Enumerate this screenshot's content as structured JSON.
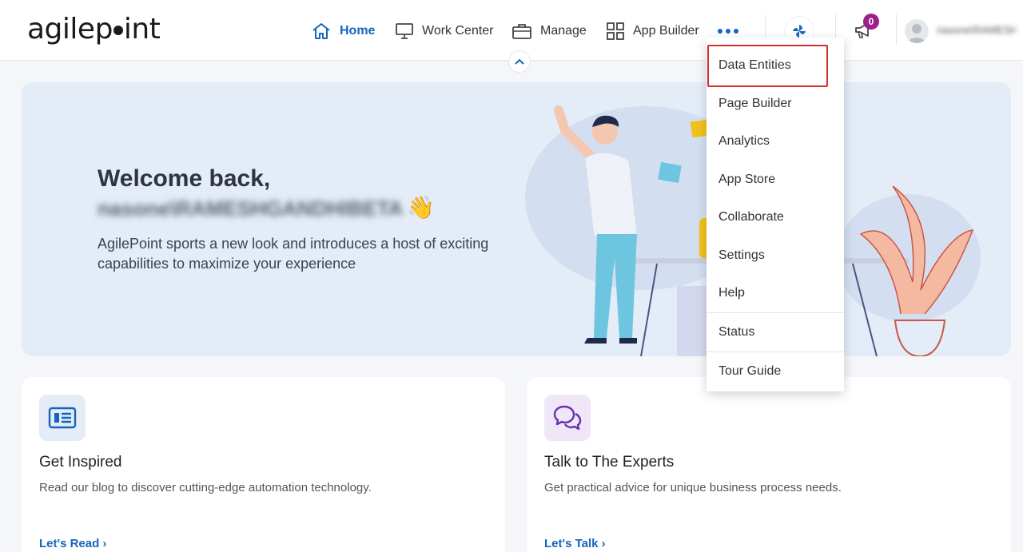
{
  "brand": {
    "logo_text_a": "agilep",
    "logo_text_b": "int"
  },
  "nav": {
    "home": "Home",
    "work_center": "Work Center",
    "manage": "Manage",
    "app_builder": "App Builder"
  },
  "notifications": {
    "count": "0"
  },
  "user": {
    "name": "nasone\\RAMESHGANDHIBETA"
  },
  "hero": {
    "title": "Welcome back,",
    "name": "nasone\\RAMESHGANDHIBETA",
    "wave": "👋",
    "description": "AgilePoint sports a new look and introduces a host of exciting capabilities to maximize your experience"
  },
  "cards": [
    {
      "title": "Get Inspired",
      "description": "Read our blog to discover cutting-edge automation technology.",
      "link": "Let's Read ›",
      "icon": "newspaper-icon"
    },
    {
      "title": "Talk to The Experts",
      "description": "Get practical advice for unique business process needs.",
      "link": "Let's Talk ›",
      "icon": "chat-bubbles-icon"
    }
  ],
  "menu": {
    "items": [
      "Data Entities",
      "Page Builder",
      "Analytics",
      "App Store",
      "Collaborate",
      "Settings",
      "Help",
      "Status",
      "Tour Guide"
    ],
    "highlighted": "Data Entities"
  },
  "colors": {
    "accent": "#1565c0",
    "badge": "#9c1f8a",
    "highlight": "#d32f2f",
    "hero_bg": "#e3ecf7"
  }
}
